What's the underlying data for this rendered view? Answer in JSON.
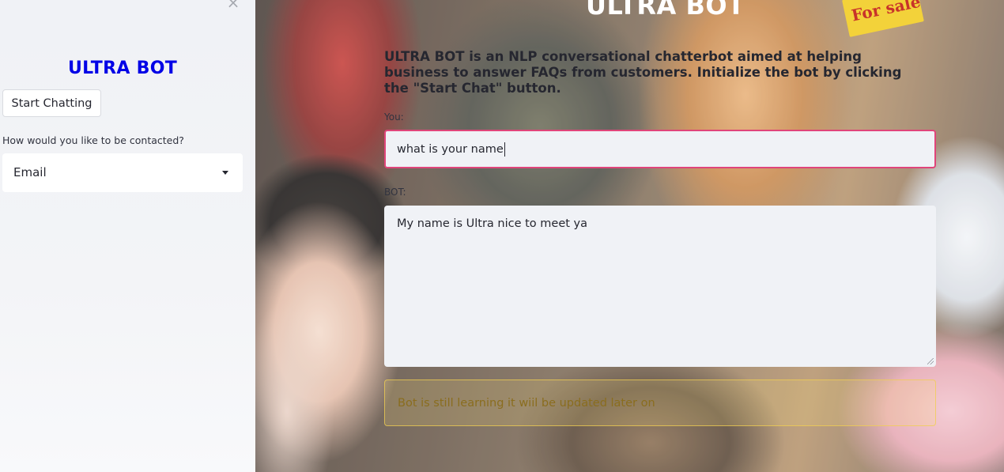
{
  "sidebar": {
    "close_symbol": "×",
    "title": "ULTRA BOT",
    "start_button": "Start Chatting",
    "contact_label": "How would you like to be contacted?",
    "contact_select": {
      "value": "Email"
    }
  },
  "main": {
    "title": "ULTRA BOT",
    "sign_text": "For sale",
    "description": "ULTRA BOT is an NLP conversational chatterbot aimed at helping business to answer FAQs from customers. Initialize the bot by clicking the \"Start Chat\" button.",
    "you_label": "You:",
    "you_value": "what is your name",
    "bot_label": "BOT:",
    "bot_response": "My name is Ultra nice to meet ya",
    "warning": "Bot is still learning it wiil be updated later on"
  },
  "colors": {
    "sidebar_title": "#0000e6",
    "input_focus_border": "#e0457a",
    "warning_border": "#f0cd50",
    "warning_text": "#8a6d1e"
  }
}
